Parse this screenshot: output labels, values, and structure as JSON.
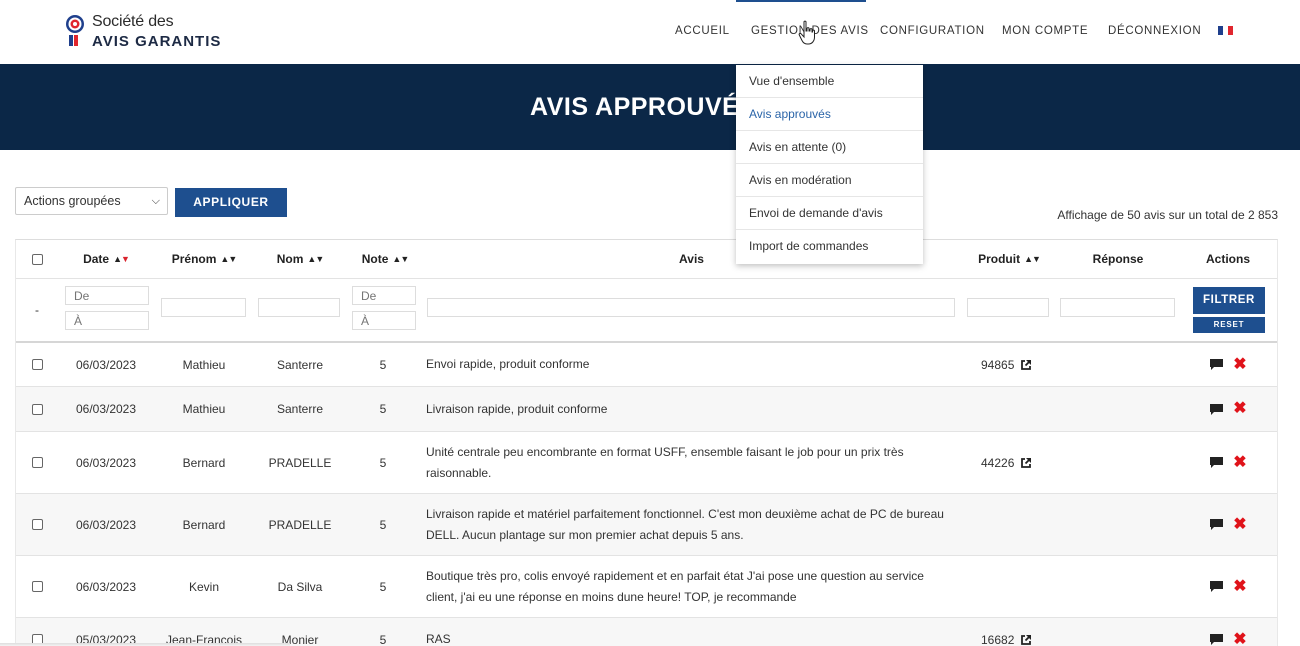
{
  "header": {
    "logo": {
      "line1": "Société des",
      "line2": "AVIS GARANTIS"
    },
    "nav": [
      {
        "label": "ACCUEIL"
      },
      {
        "label": "GESTION DES AVIS"
      },
      {
        "label": "CONFIGURATION"
      },
      {
        "label": "MON COMPTE"
      },
      {
        "label": "DÉCONNEXION"
      }
    ],
    "flag_colors": [
      "#1f3f8c",
      "#ffffff",
      "#e0262e"
    ]
  },
  "banner": {
    "title": "AVIS APPROUVÉS"
  },
  "dropdown": {
    "items": [
      {
        "label": "Vue d'ensemble"
      },
      {
        "label": "Avis approuvés"
      },
      {
        "label": "Avis en attente (0)"
      },
      {
        "label": "Avis en modération"
      },
      {
        "label": "Envoi de demande d'avis"
      },
      {
        "label": "Import de commandes"
      }
    ],
    "active_index": 1
  },
  "toolbar": {
    "bulk_actions_selected": "Actions groupées",
    "apply_label": "APPLIQUER",
    "count_text": "Affichage de 50 avis sur un total de 2 853"
  },
  "table": {
    "columns": {
      "date": "Date",
      "firstname": "Prénom",
      "lastname": "Nom",
      "rating": "Note",
      "review": "Avis",
      "product": "Produit",
      "reply": "Réponse",
      "actions": "Actions"
    },
    "filters": {
      "dash": "-",
      "date_from_placeholder": "De",
      "date_to_placeholder": "À",
      "note_from_placeholder": "De",
      "note_to_placeholder": "À",
      "filter_label": "FILTRER",
      "reset_label": "RESET"
    },
    "rows": [
      {
        "date": "06/03/2023",
        "firstname": "Mathieu",
        "lastname": "Santerre",
        "rating": "5",
        "review": "Envoi rapide, produit conforme",
        "product": "94865"
      },
      {
        "date": "06/03/2023",
        "firstname": "Mathieu",
        "lastname": "Santerre",
        "rating": "5",
        "review": "Livraison rapide, produit conforme",
        "product": ""
      },
      {
        "date": "06/03/2023",
        "firstname": "Bernard",
        "lastname": "PRADELLE",
        "rating": "5",
        "review": "Unité centrale peu encombrante en format USFF, ensemble faisant le job pour un prix très raisonnable.",
        "product": "44226"
      },
      {
        "date": "06/03/2023",
        "firstname": "Bernard",
        "lastname": "PRADELLE",
        "rating": "5",
        "review": "Livraison rapide et matériel parfaitement fonctionnel. C'est mon deuxième achat de PC de bureau DELL. Aucun plantage sur mon premier achat depuis 5 ans.",
        "product": ""
      },
      {
        "date": "06/03/2023",
        "firstname": "Kevin",
        "lastname": "Da Silva",
        "rating": "5",
        "review": "Boutique très pro, colis envoyé rapidement et en parfait état J'ai pose une question au service client, j'ai eu une réponse en moins dune heure! TOP, je recommande",
        "product": ""
      },
      {
        "date": "05/03/2023",
        "firstname": "Jean-François",
        "lastname": "Monier",
        "rating": "5",
        "review": "RAS",
        "product": "16682"
      }
    ]
  }
}
